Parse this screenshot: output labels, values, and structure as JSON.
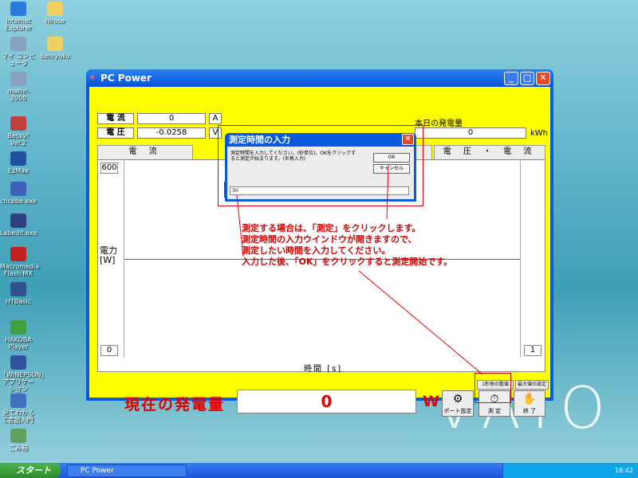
{
  "desktop_icons": [
    {
      "label": "Internet Explorer",
      "color": "#2a7ae0"
    },
    {
      "label": "hirose",
      "color": "#f0d060"
    },
    {
      "label": "マイ コンピュータ",
      "color": "#8aa0c0"
    },
    {
      "label": "denryoku",
      "color": "#f0d060"
    },
    {
      "label": "mathr-2000",
      "color": "#8aa0c0"
    },
    {
      "label": "Becky! Ver.2",
      "color": "#c04040"
    },
    {
      "label": "EzMax",
      "color": "#2050a0"
    },
    {
      "label": "chcebe.exe",
      "color": "#4060c0"
    },
    {
      "label": "Labedit.exe",
      "color": "#304080"
    },
    {
      "label": "Macromedia Flash MX",
      "color": "#c02020"
    },
    {
      "label": "HTBasic",
      "color": "#305090"
    },
    {
      "label": "HAKOBA Player",
      "color": "#40a040"
    },
    {
      "label": "「WINEPSON」アプリケーション",
      "color": "#3050a0"
    },
    {
      "label": "見てわかる C言語入門",
      "color": "#4070c0"
    },
    {
      "label": "ごみ箱",
      "color": "#60a060"
    }
  ],
  "window": {
    "title": "PC Power",
    "current_label": "電 流",
    "current_value": "0",
    "current_unit": "A",
    "voltage_label": "電 圧",
    "voltage_value": "-0.0258",
    "voltage_unit": "V",
    "today_label": "本日の発電量",
    "today_value": "0",
    "today_unit": "kWh",
    "tabs": [
      "電 流",
      "",
      "電 圧 ・ 電 流"
    ],
    "graph": {
      "ylabel_top": "電力",
      "ylabel_unit": "[W]",
      "ymax": "600",
      "ymin": "0",
      "xlabel": "時間 [s]",
      "xmax": "1"
    },
    "small_buttons": [
      "1秒毎の数値",
      "最大値の設定"
    ],
    "gen_label": "現在の発電量",
    "gen_value": "0",
    "gen_unit": "W",
    "tools": [
      {
        "label": "ポート設定",
        "glyph": "⚙"
      },
      {
        "label": "測 定",
        "glyph": "⏱"
      },
      {
        "label": "終 了",
        "glyph": "✋"
      }
    ]
  },
  "dialog": {
    "title": "測定時間の入力",
    "message": "測定時間を入力してください。(秒単位)。OKをクリックすると測定が始まります。(半角入力)",
    "ok": "OK",
    "cancel": "キャンセル",
    "input_value": "30"
  },
  "annotation": [
    "測定する場合は、「測定」をクリックします。",
    "測定時間の入力ウインドウが開きますので、",
    "測定したい時間を入力してください。",
    "入力した後、「OK」をクリックすると測定開始です。"
  ],
  "wallpaper_logo": "VAIO",
  "taskbar": {
    "start": "スタート",
    "task": "PC Power",
    "clock": "18:42"
  }
}
